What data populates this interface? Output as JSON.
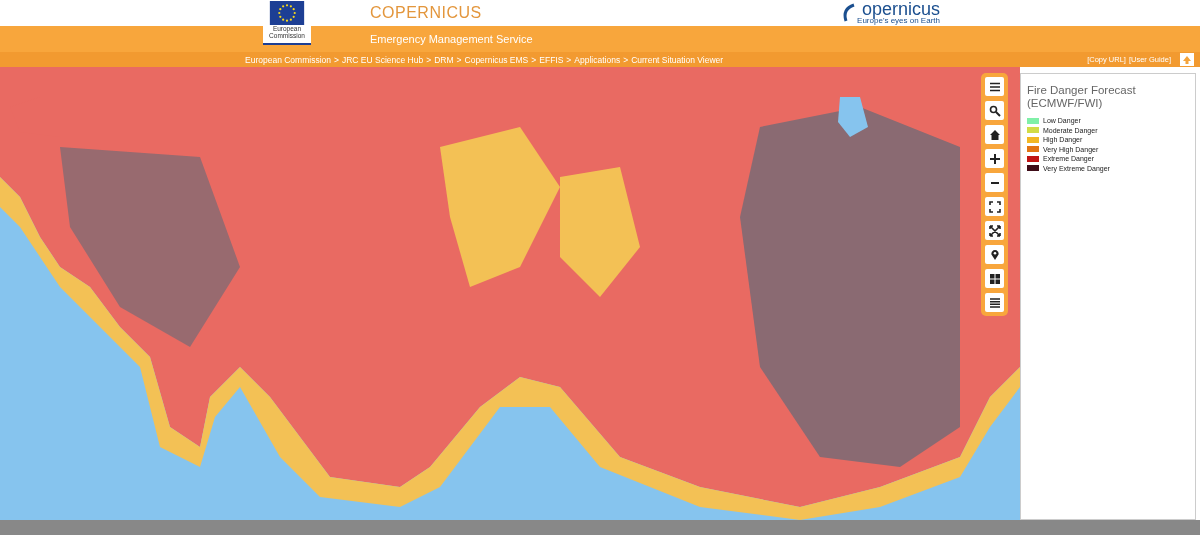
{
  "header": {
    "ec_logo_text": "European Commission",
    "title": "COPERNICUS",
    "subtitle": "Emergency Management Service",
    "copernicus_logo": {
      "wordmark": "opernicus",
      "tagline": "Europe's eyes on Earth"
    }
  },
  "breadcrumb": [
    "European Commission",
    "JRC EU Science Hub",
    "DRM",
    "Copernicus EMS",
    "EFFIS",
    "Applications",
    "Current Situation Viewer"
  ],
  "breadcrumb_separator": ">",
  "header_links": [
    "[Copy URL]",
    "[User Guide]"
  ],
  "legend": {
    "title": "Fire Danger Forecast (ECMWF/FWI)",
    "items": [
      {
        "label": "Low Danger",
        "color": "#80f0a8"
      },
      {
        "label": "Moderate Danger",
        "color": "#d2dc46"
      },
      {
        "label": "High Danger",
        "color": "#f2b824"
      },
      {
        "label": "Very High Danger",
        "color": "#e27414"
      },
      {
        "label": "Extreme Danger",
        "color": "#c01414"
      },
      {
        "label": "Very Extreme Danger",
        "color": "#3e0c18"
      }
    ]
  }
}
